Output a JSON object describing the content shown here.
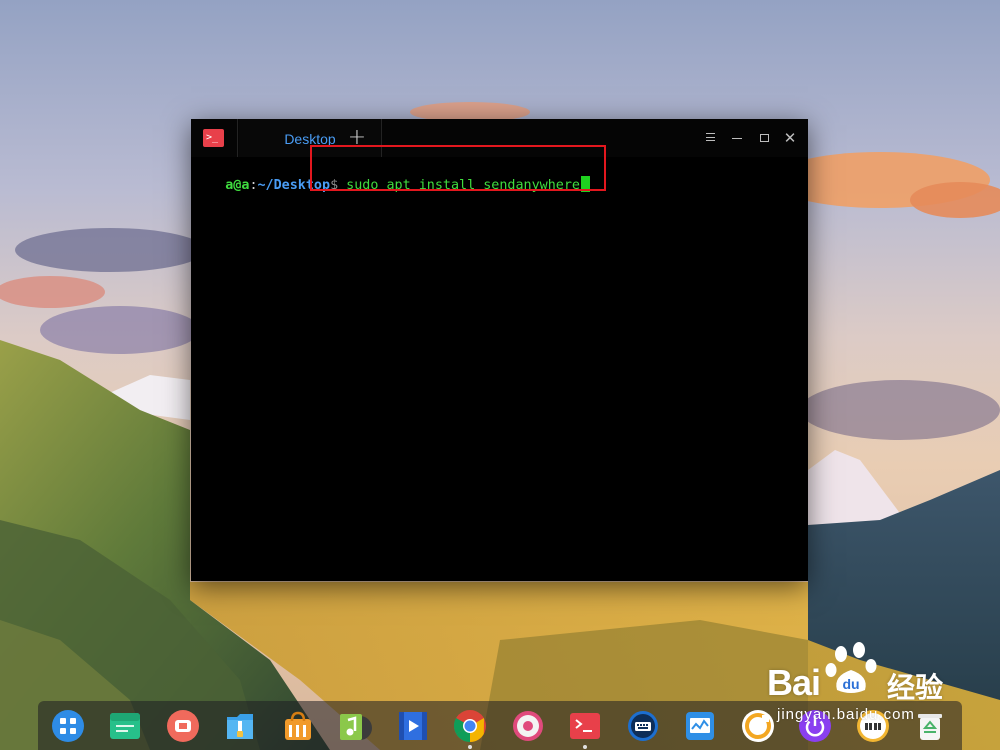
{
  "terminal": {
    "tab_title": "Desktop",
    "new_tab_symbol": "+",
    "close_symbol": "✕",
    "app_icon_glyph": ">_",
    "prompt_user": "a@a",
    "prompt_colon": ":",
    "prompt_path": "~/Desktop",
    "prompt_dollar": "$",
    "command": " sudo apt install sendanywhere"
  },
  "highlight_color": "#e3171e",
  "dock": {
    "icons": [
      {
        "name": "launcher-icon",
        "running": false
      },
      {
        "name": "file-manager-icon",
        "running": false
      },
      {
        "name": "screen-recorder-icon",
        "running": false
      },
      {
        "name": "archive-manager-icon",
        "running": false
      },
      {
        "name": "app-store-icon",
        "running": false
      },
      {
        "name": "music-player-icon",
        "running": false
      },
      {
        "name": "video-player-icon",
        "running": false
      },
      {
        "name": "chrome-browser-icon",
        "running": true
      },
      {
        "name": "control-center-icon",
        "running": false
      },
      {
        "name": "terminal-icon",
        "running": true
      },
      {
        "name": "input-method-icon",
        "running": false
      },
      {
        "name": "system-monitor-icon",
        "running": false
      },
      {
        "name": "update-icon",
        "running": false
      },
      {
        "name": "power-icon",
        "running": false
      },
      {
        "name": "clock-icon",
        "running": false
      },
      {
        "name": "trash-icon",
        "running": false
      }
    ]
  },
  "watermark": {
    "baidu": "Bai",
    "brand": "经验",
    "site": "jingyan.baidu.com"
  }
}
